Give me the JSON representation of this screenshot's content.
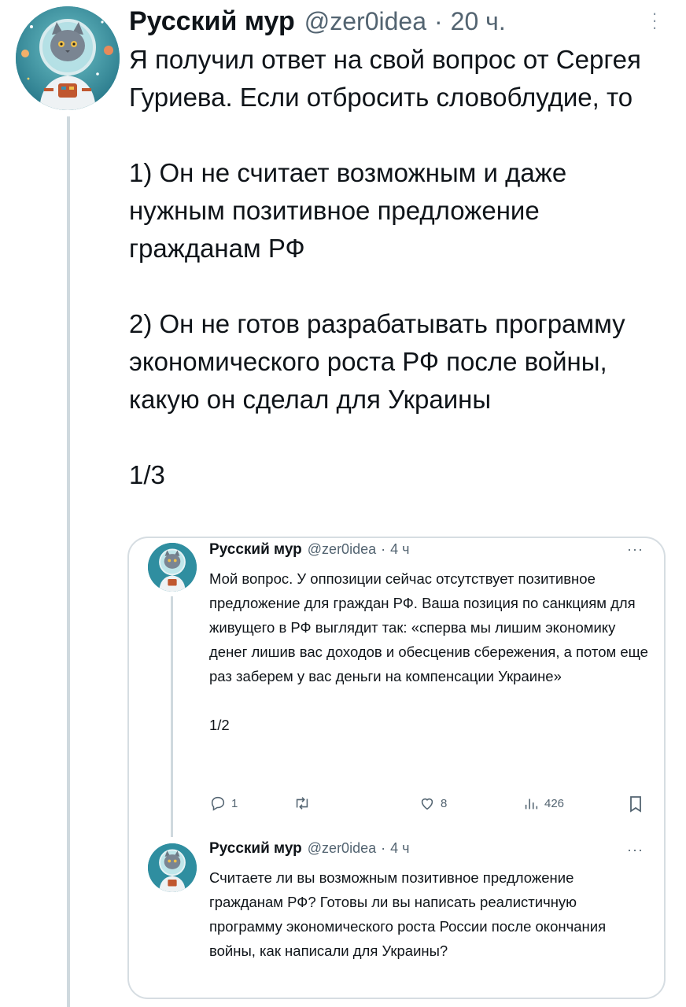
{
  "tweet": {
    "author_name": "Русский мур",
    "author_handle": "@zer0idea",
    "separator": "·",
    "time": "20 ч.",
    "more_label": "⋮",
    "paragraphs": [
      "Я получил ответ на свой вопрос от Сергея Гуриева. Если отбросить словоблудие, то",
      "1) Он не считает возможным и даже нужным позитивное предложение гражданам РФ",
      "2) Он не готов разрабатывать программу экономического роста РФ после войны, какую он сделал для Украины",
      "1/3"
    ],
    "avatar_icon": "astronaut-cat-avatar"
  },
  "quoted_thread": {
    "posts": [
      {
        "author_name": "Русский мур",
        "author_handle": "@zer0idea",
        "separator": "·",
        "time": "4 ч",
        "more_label": "···",
        "paragraphs": [
          "Мой вопрос. У оппозиции сейчас отсутствует позитивное предложение для граждан РФ. Ваша позиция по санкциям для живущего в РФ выглядит так: «сперва мы лишим экономику денег лишив вас доходов и обесценив сбережения, а потом еще раз заберем у вас деньги на компенсации Украине»",
          "1/2"
        ],
        "actions": {
          "replies": "1",
          "retweets": "",
          "likes": "8",
          "views": "426",
          "reply_icon": "reply-icon",
          "retweet_icon": "retweet-icon",
          "like_icon": "heart-icon",
          "views_icon": "views-icon",
          "bookmark_icon": "bookmark-icon"
        }
      },
      {
        "author_name": "Русский мур",
        "author_handle": "@zer0idea",
        "separator": "·",
        "time": "4 ч",
        "more_label": "···",
        "paragraphs": [
          "Считаете ли вы возможным позитивное предложение гражданам РФ? Готовы ли вы написать реалистичную программу экономического роста России после окончания войны, как написали для Украины?"
        ]
      }
    ]
  },
  "colors": {
    "text_primary": "#0f1419",
    "text_secondary": "#536471",
    "border": "#d6dde2",
    "thread_line": "#cfd9de",
    "avatar_bg": "#2c8a9e"
  }
}
